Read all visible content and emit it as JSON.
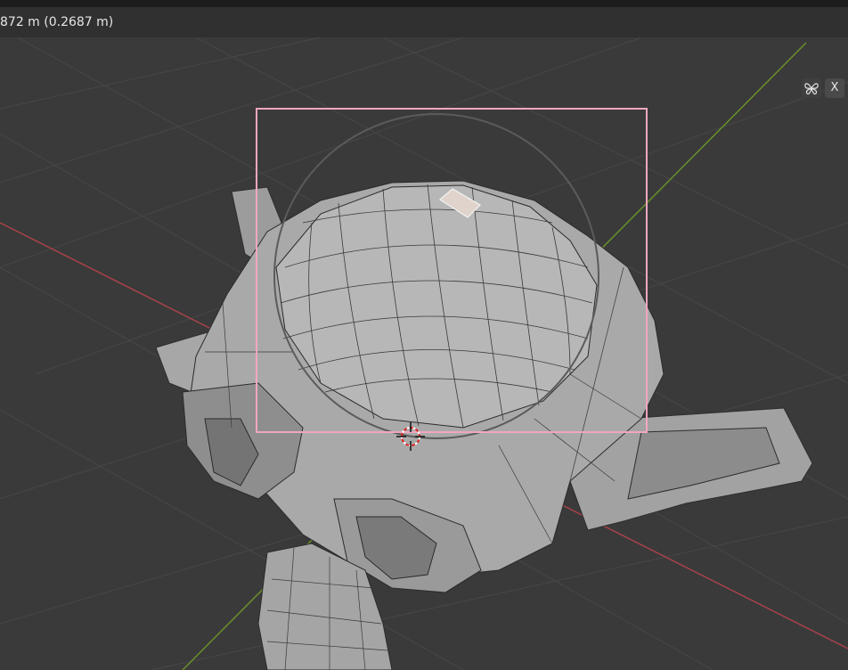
{
  "header": {
    "measurement_text": "872 m (0.2687 m)"
  },
  "viewport": {
    "background_color": "#3a3a3a",
    "grid_color": "#444444",
    "x_axis_color": "#a6424a",
    "y_axis_color": "#6a8f2c",
    "selection_box_color": "#f1a7c0",
    "mesh_face_color": "#a9a9a9",
    "mesh_edge_color": "#2b2b2b",
    "selected_face_color": "#e0d3cc"
  },
  "overlay_buttons": {
    "xray_icon": "butterfly-icon",
    "x_label": "X"
  }
}
